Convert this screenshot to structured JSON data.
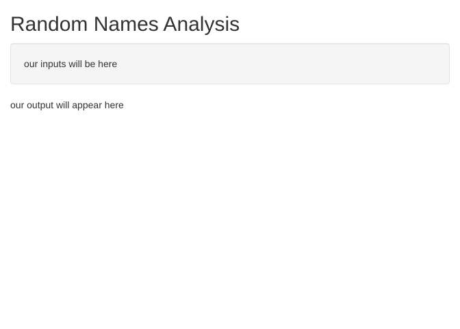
{
  "page": {
    "title": "Random Names Analysis"
  },
  "inputs_panel": {
    "text": "our inputs will be here"
  },
  "output_panel": {
    "text": "our output will appear here"
  },
  "colors": {
    "text": "#333333",
    "well_background": "#f5f5f5",
    "well_border": "#e3e3e3",
    "page_background": "#ffffff"
  }
}
